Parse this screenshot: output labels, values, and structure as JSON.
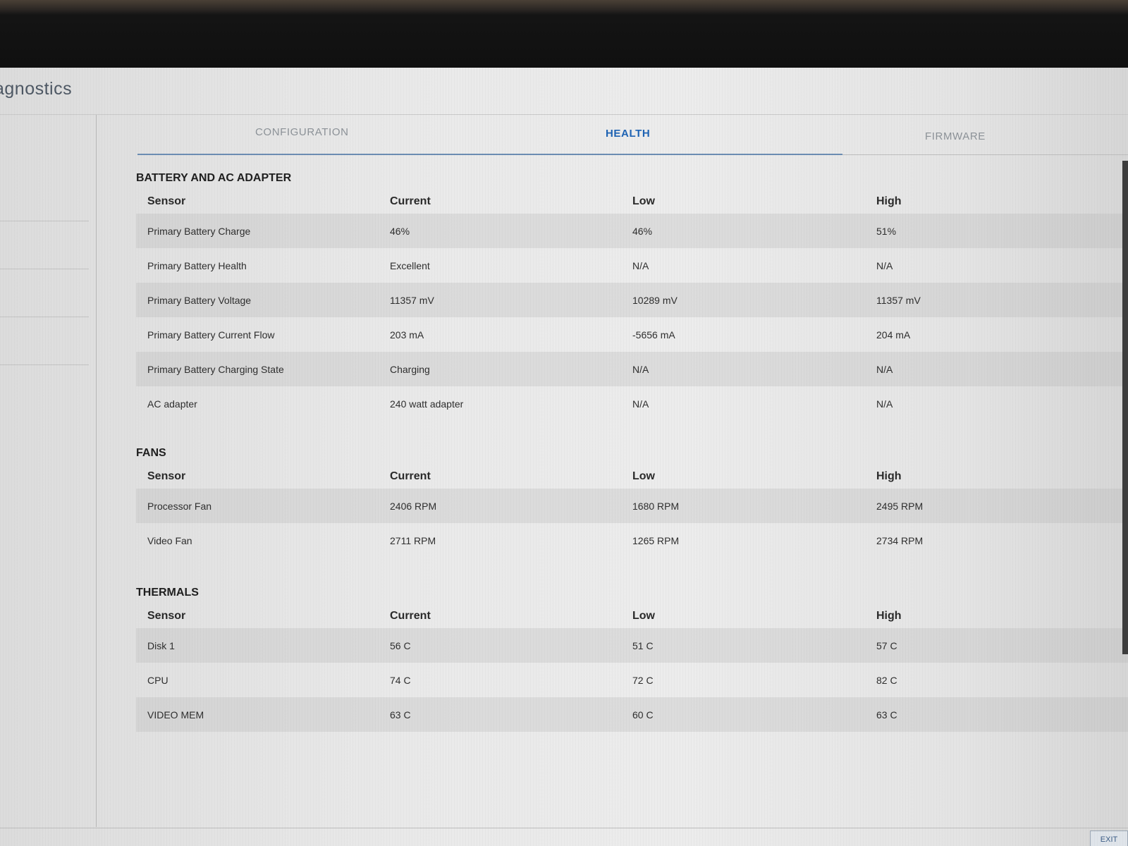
{
  "app": {
    "title": "agnostics"
  },
  "tabs": [
    {
      "label": "CONFIGURATION",
      "active": false
    },
    {
      "label": "HEALTH",
      "active": true
    },
    {
      "label": "FIRMWARE",
      "active": false
    }
  ],
  "columns": {
    "sensor": "Sensor",
    "current": "Current",
    "low": "Low",
    "high": "High"
  },
  "battery": {
    "title": "BATTERY AND AC ADAPTER",
    "rows": [
      {
        "sensor": "Primary Battery Charge",
        "current": "46%",
        "low": "46%",
        "high": "51%"
      },
      {
        "sensor": "Primary Battery Health",
        "current": "Excellent",
        "low": "N/A",
        "high": "N/A"
      },
      {
        "sensor": "Primary Battery Voltage",
        "current": "11357 mV",
        "low": "10289 mV",
        "high": "11357 mV"
      },
      {
        "sensor": "Primary Battery Current Flow",
        "current": "203 mA",
        "low": "-5656 mA",
        "high": "204 mA"
      },
      {
        "sensor": "Primary Battery Charging State",
        "current": "Charging",
        "low": "N/A",
        "high": "N/A"
      },
      {
        "sensor": "AC adapter",
        "current": "240 watt adapter",
        "low": "N/A",
        "high": "N/A"
      }
    ]
  },
  "fans": {
    "title": "FANS",
    "rows": [
      {
        "sensor": "Processor Fan",
        "current": "2406 RPM",
        "low": "1680 RPM",
        "high": "2495 RPM"
      },
      {
        "sensor": "Video Fan",
        "current": "2711 RPM",
        "low": "1265 RPM",
        "high": "2734 RPM"
      }
    ]
  },
  "thermals": {
    "title": "THERMALS",
    "rows": [
      {
        "sensor": "Disk 1",
        "current": "56 C",
        "low": "51 C",
        "high": "57 C"
      },
      {
        "sensor": "CPU",
        "current": "74 C",
        "low": "72 C",
        "high": "82 C"
      },
      {
        "sensor": "VIDEO MEM",
        "current": "63 C",
        "low": "60 C",
        "high": "63 C"
      }
    ]
  },
  "footer": {
    "exit_label": "EXIT"
  },
  "colors": {
    "accent": "#1e63b4",
    "tab_inactive": "#8c9298"
  }
}
